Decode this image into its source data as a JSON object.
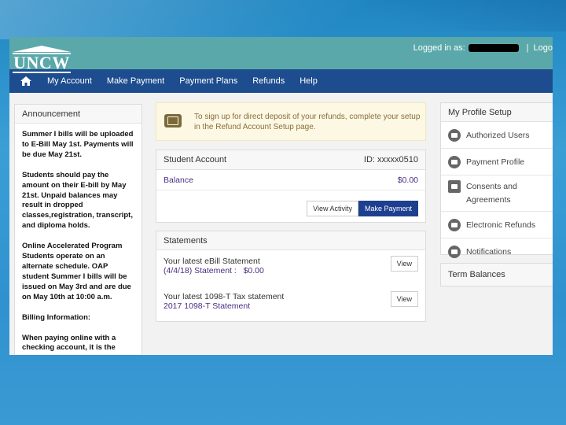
{
  "header": {
    "logo_text": "UNCW",
    "logged_in_label": "Logged in as:",
    "logout_label": "Logo"
  },
  "nav": {
    "items": [
      "My Account",
      "Make Payment",
      "Payment Plans",
      "Refunds",
      "Help"
    ]
  },
  "announcement": {
    "title": "Announcement",
    "paragraphs": [
      "Summer I bills will be uploaded to E-Bill May 1st. Payments will be due May 21st.",
      "Students should pay the amount on their E-bill by May 21st. Unpaid balances may result in dropped classes,registration, transcript, and diploma holds.",
      "Online Accelerated Program Students operate on an alternate schedule. OAP student Summer I bills will be issued on May 3rd and are due on May 10th at 10:00 a.m.",
      "Billing Information:",
      "When paying online with a checking account, it is the"
    ]
  },
  "alert": {
    "text_before": "To sign up for direct deposit of your refunds, complete your setup in the ",
    "link_text": "Refund Account Setup",
    "text_after": " page."
  },
  "student_account": {
    "title": "Student Account",
    "id_label": "ID: xxxxx0510",
    "balance_label": "Balance",
    "balance_value": "$0.00",
    "view_activity_label": "View Activity",
    "make_payment_label": "Make Payment"
  },
  "statements": {
    "title": "Statements",
    "ebill_label": "Your latest eBill Statement",
    "ebill_date": "(4/4/18)",
    "ebill_link": "Statement :",
    "ebill_amount": "$0.00",
    "tax_label": "Your latest 1098-T Tax statement",
    "tax_link": "2017 1098-T Statement",
    "view_label": "View"
  },
  "profile": {
    "title": "My Profile Setup",
    "items": [
      "Authorized Users",
      "Payment Profile",
      "Consents and Agreements",
      "Electronic Refunds",
      "Notifications"
    ]
  },
  "term_balances": {
    "title": "Term Balances"
  }
}
